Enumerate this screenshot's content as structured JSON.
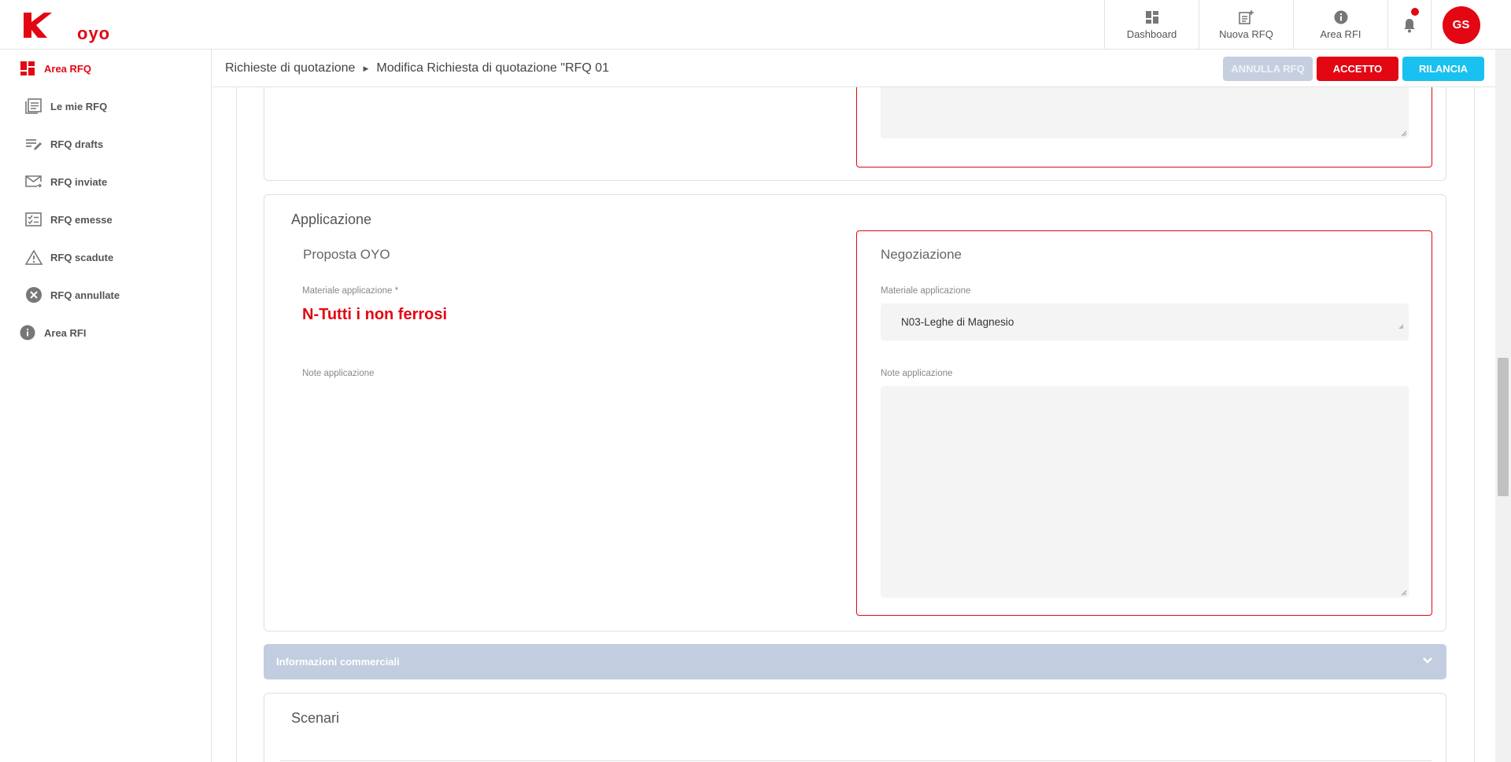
{
  "brand": {
    "name": "oyo",
    "accent": "#e30613",
    "info_color": "#18c1f0"
  },
  "topnav": {
    "dashboard": "Dashboard",
    "new_rfq": "Nuova RFQ",
    "area_rfi": "Area RFI",
    "avatar_initials": "GS"
  },
  "sidebar": {
    "items": [
      {
        "label": "Area RFQ",
        "icon": "dashboard-icon"
      },
      {
        "label": "Le mie RFQ",
        "icon": "list-icon"
      },
      {
        "label": "RFQ drafts",
        "icon": "edit-list-icon"
      },
      {
        "label": "RFQ inviate",
        "icon": "mail-send-icon"
      },
      {
        "label": "RFQ emesse",
        "icon": "checklist-icon"
      },
      {
        "label": "RFQ scadute",
        "icon": "warning-icon"
      },
      {
        "label": "RFQ annullate",
        "icon": "cancel-icon"
      },
      {
        "label": "Area RFI",
        "icon": "info-icon"
      }
    ]
  },
  "breadcrumb": {
    "first": "Richieste di quotazione",
    "second": "Modifica Richiesta di quotazione \"RFQ 01"
  },
  "actions": {
    "annulla": "ANNULLA RFQ",
    "accetto": "ACCETTO",
    "rilancia": "RILANCIA"
  },
  "application": {
    "title": "Applicazione",
    "proposal_title": "Proposta OYO",
    "material_label": "Materiale applicazione *",
    "material_value": "N-Tutti i non ferrosi",
    "notes_label": "Note applicazione",
    "negotiation_title": "Negoziazione",
    "neg_material_label": "Materiale applicazione",
    "neg_material_value": "N03-Leghe di Magnesio",
    "neg_notes_label": "Note applicazione"
  },
  "commercial": {
    "title": "Informazioni commerciali"
  },
  "scenari": {
    "title": "Scenari"
  }
}
